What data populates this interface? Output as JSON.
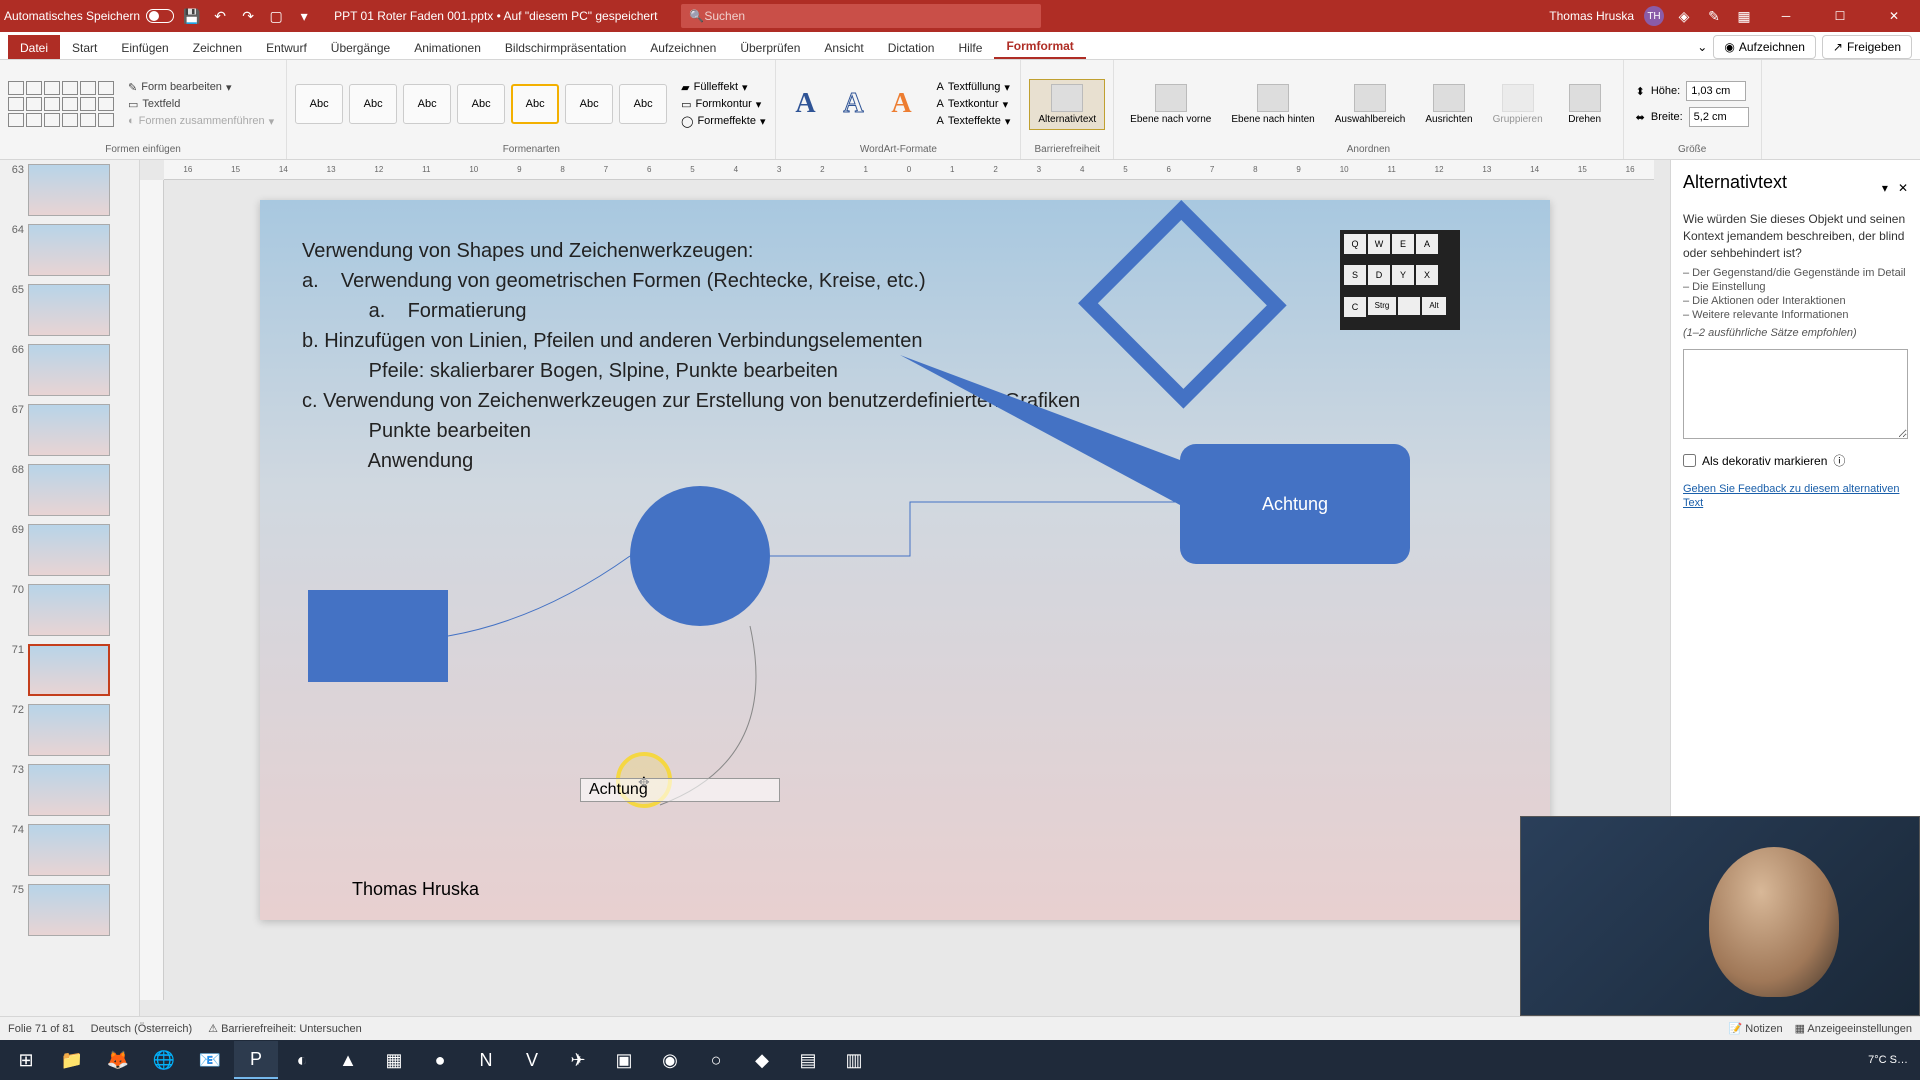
{
  "titlebar": {
    "autosave_label": "Automatisches Speichern",
    "filename": "PPT 01 Roter Faden 001.pptx • Auf \"diesem PC\" gespeichert",
    "search_placeholder": "Suchen",
    "user_name": "Thomas Hruska",
    "user_initials": "TH"
  },
  "menu": {
    "tabs": [
      "Datei",
      "Start",
      "Einfügen",
      "Zeichnen",
      "Entwurf",
      "Übergänge",
      "Animationen",
      "Bildschirmpräsentation",
      "Aufzeichnen",
      "Überprüfen",
      "Ansicht",
      "Dictation",
      "Hilfe",
      "Formformat"
    ],
    "active_index": 13,
    "record": "Aufzeichnen",
    "share": "Freigeben"
  },
  "ribbon": {
    "shapes": {
      "edit_shape": "Form bearbeiten",
      "textfield": "Textfeld",
      "merge": "Formen zusammenführen",
      "group_label": "Formen einfügen"
    },
    "styles": {
      "label_list": [
        "Abc",
        "Abc",
        "Abc",
        "Abc",
        "Abc",
        "Abc",
        "Abc"
      ],
      "fill": "Fülleffekt",
      "contour": "Formkontur",
      "effects": "Formeffekte",
      "group_label": "Formenarten"
    },
    "wordart": {
      "text_fill": "Textfüllung",
      "text_contour": "Textkontur",
      "text_effects": "Texteffekte",
      "group_label": "WordArt-Formate"
    },
    "access": {
      "alttext": "Alternativtext",
      "group_label": "Barrierefreiheit"
    },
    "arrange": {
      "front": "Ebene nach vorne",
      "back": "Ebene nach hinten",
      "selection": "Auswahlbereich",
      "align": "Ausrichten",
      "group": "Gruppieren",
      "rotate": "Drehen",
      "group_label": "Anordnen"
    },
    "size": {
      "height_label": "Höhe:",
      "height_val": "1,03 cm",
      "width_label": "Breite:",
      "width_val": "5,2 cm",
      "group_label": "Größe"
    }
  },
  "slides": {
    "numbers": [
      "63",
      "64",
      "65",
      "66",
      "67",
      "68",
      "69",
      "70",
      "71",
      "72",
      "73",
      "74",
      "75"
    ],
    "active_index": 8
  },
  "canvas": {
    "title_lines": [
      "Verwendung von Shapes und Zeichenwerkzeugen:",
      "a.    Verwendung von geometrischen Formen (Rechtecke, Kreise, etc.)",
      "            a.    Formatierung",
      "b. Hinzufügen von Linien, Pfeilen und anderen Verbindungselementen",
      "            Pfeile: skalierbarer Bogen, Slpine, Punkte bearbeiten",
      "c. Verwendung von Zeichenwerkzeugen zur Erstellung von benutzerdefinierten Grafiken",
      "            Punkte bearbeiten",
      "            Anwendung"
    ],
    "roundbox_label": "Achtung",
    "textbox_label": "Achtung",
    "footer": "Thomas Hruska"
  },
  "ruler": [
    "16",
    "15",
    "14",
    "13",
    "12",
    "11",
    "10",
    "9",
    "8",
    "7",
    "6",
    "5",
    "4",
    "3",
    "2",
    "1",
    "0",
    "1",
    "2",
    "3",
    "4",
    "5",
    "6",
    "7",
    "8",
    "9",
    "10",
    "11",
    "12",
    "13",
    "14",
    "15",
    "16"
  ],
  "alt_panel": {
    "title": "Alternativtext",
    "desc": "Wie würden Sie dieses Objekt und seinen Kontext jemandem beschreiben, der blind oder sehbehindert ist?",
    "bullet1": "– Der Gegenstand/die Gegenstände im Detail",
    "bullet2": "– Die Einstellung",
    "bullet3": "– Die Aktionen oder Interaktionen",
    "bullet4": "– Weitere relevante Informationen",
    "hint": "(1–2 ausführliche Sätze empfohlen)",
    "decorative": "Als dekorativ markieren",
    "feedback": "Geben Sie Feedback zu diesem alternativen Text"
  },
  "status": {
    "slide_info": "Folie 71 of 81",
    "lang": "Deutsch (Österreich)",
    "access": "Barrierefreiheit: Untersuchen",
    "notes": "Notizen",
    "display": "Anzeigeeinstellungen"
  },
  "taskbar": {
    "weather": "7°C S…"
  }
}
